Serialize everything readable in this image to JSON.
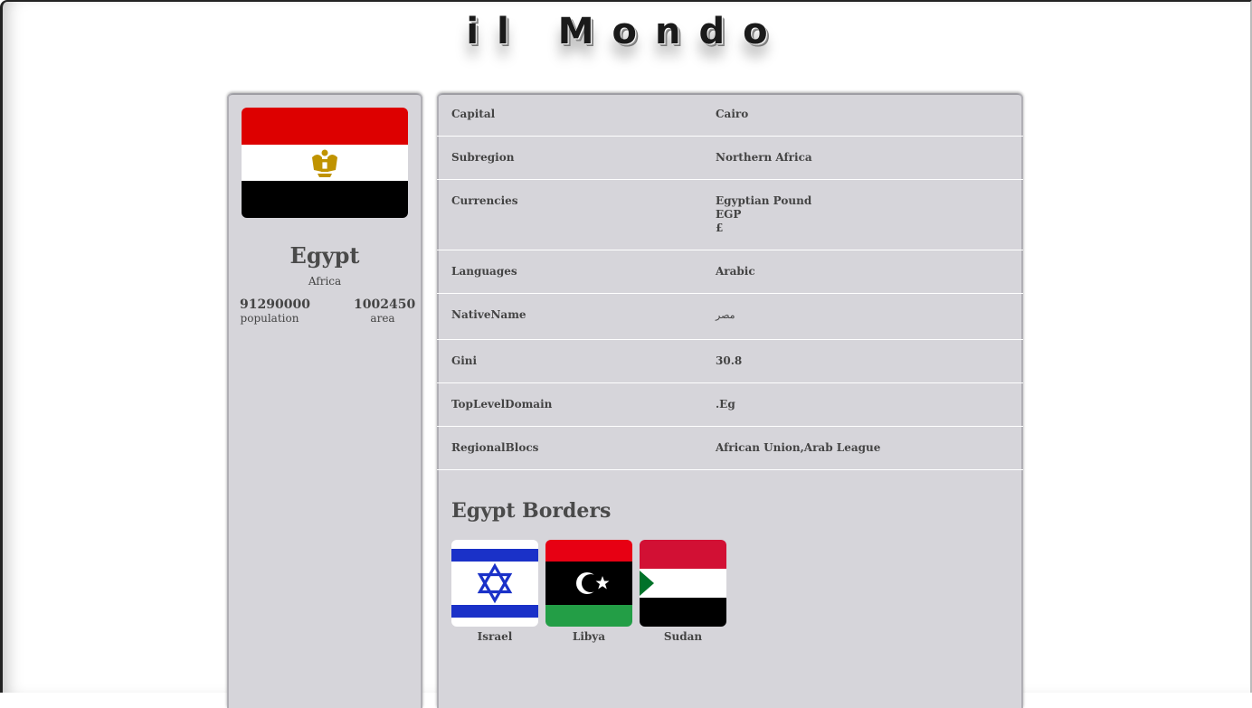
{
  "app": {
    "title": "il Mondo"
  },
  "country": {
    "name": "Egypt",
    "region": "Africa",
    "population": "91290000",
    "population_label": "population",
    "area": "1002450",
    "area_label": "area",
    "flag_colors": [
      "#dd0000",
      "#ffffff",
      "#000000"
    ],
    "flag_icon": "egypt-flag-icon"
  },
  "details": {
    "rows": [
      {
        "key": "Capital",
        "value": [
          "Cairo"
        ]
      },
      {
        "key": "Subregion",
        "value": [
          "Northern Africa"
        ]
      },
      {
        "key": "Currencies",
        "value": [
          "Egyptian Pound",
          "EGP",
          "£"
        ]
      },
      {
        "key": "Languages",
        "value": [
          "Arabic"
        ]
      },
      {
        "key": "NativeName",
        "value": [
          "مصر"
        ]
      },
      {
        "key": "Gini",
        "value": [
          "30.8"
        ]
      },
      {
        "key": "TopLevelDomain",
        "value": [
          ".Eg"
        ]
      },
      {
        "key": "RegionalBlocs",
        "value": [
          "African Union,Arab League"
        ]
      }
    ]
  },
  "borders": {
    "title": "Egypt Borders",
    "items": [
      {
        "name": "Israel",
        "icon": "israel-flag-icon"
      },
      {
        "name": "Libya",
        "icon": "libya-flag-icon"
      },
      {
        "name": "Sudan",
        "icon": "sudan-flag-icon"
      }
    ]
  }
}
